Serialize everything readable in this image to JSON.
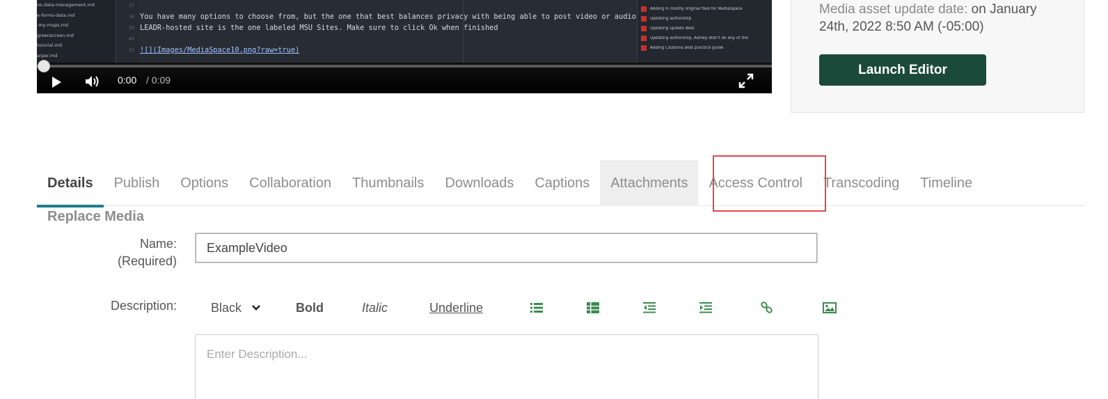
{
  "player": {
    "file_tree": [
      "ns-data-management.md",
      "e-forms-data.md",
      "-my-maps.md",
      "greenscreen.md",
      "tutorial.md",
      "arper.md"
    ],
    "line_numbers": [
      "37",
      "38",
      "39",
      "40",
      "41"
    ],
    "code_lines": [
      "You have many options to choose from, but the one that best balances privacy with being able to post video or audio to a",
      "LEADR-hosted site is the one labeled MSU Sites. Make sure to click Ok when finished",
      "",
      "![](Images/MediaSpace10.png?raw=true)"
    ],
    "commits": [
      "Adding in mostly original files for MediaSpace",
      "Updating authorship",
      "Updating update date",
      "Updating authorship, Ashley didn't do any of the",
      "Adding Citations best practice guide"
    ],
    "time_current": "0:00",
    "time_total": "/ 0:09",
    "progress": 0
  },
  "side_panel": {
    "update_label": "Media asset update date:",
    "update_value": "on January 24th, 2022 8:50 AM (-05:00)",
    "launch_editor": "Launch Editor"
  },
  "tabs": [
    {
      "label": "Details",
      "active": true
    },
    {
      "label": "Publish"
    },
    {
      "label": "Options"
    },
    {
      "label": "Collaboration"
    },
    {
      "label": "Thumbnails"
    },
    {
      "label": "Downloads"
    },
    {
      "label": "Captions"
    },
    {
      "label": "Attachments",
      "hovered": true
    },
    {
      "label": "Access Control",
      "highlighted": true
    },
    {
      "label": "Transcoding"
    },
    {
      "label": "Timeline"
    }
  ],
  "form": {
    "section_title": "Replace Media",
    "name_label": "Name:",
    "name_required": "(Required)",
    "name_value": "ExampleVideo",
    "description_label": "Description:",
    "color_select": "Black",
    "bold": "Bold",
    "italic": "Italic",
    "underline": "Underline",
    "description_placeholder": "Enter Description..."
  },
  "colors": {
    "tab_underline": "#1e7e8a",
    "launch_button": "#1c4a3a",
    "toolbar_icon": "#3c8a4f",
    "highlight": "#e0474c"
  },
  "icons": [
    "play-icon",
    "volume-icon",
    "fullscreen-icon",
    "chevron-down-icon",
    "bullet-list-icon",
    "numbered-list-icon",
    "outdent-icon",
    "indent-icon",
    "link-icon",
    "image-icon"
  ]
}
